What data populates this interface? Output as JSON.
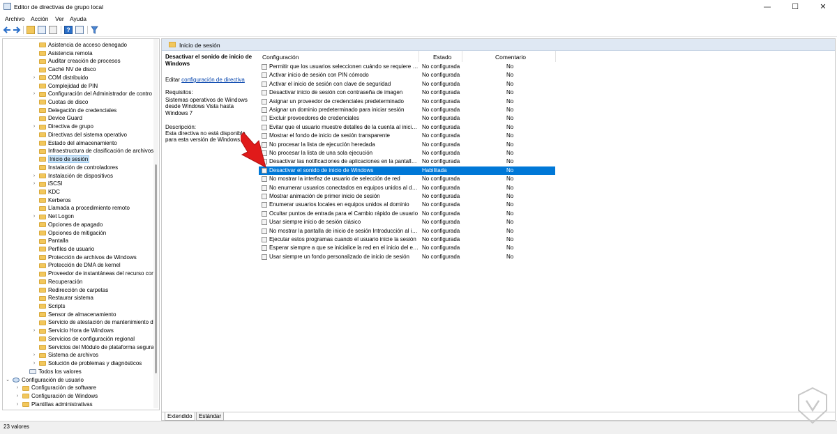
{
  "window": {
    "title": "Editor de directivas de grupo local",
    "controls": [
      "—",
      "☐",
      "✕"
    ]
  },
  "menu": [
    "Archivo",
    "Acción",
    "Ver",
    "Ayuda"
  ],
  "tree": [
    {
      "label": "Asistencia de acceso denegado",
      "level": 4,
      "expand": ""
    },
    {
      "label": "Asistencia remota",
      "level": 4,
      "expand": ""
    },
    {
      "label": "Auditar creación de procesos",
      "level": 4,
      "expand": ""
    },
    {
      "label": "Caché NV de disco",
      "level": 4,
      "expand": ""
    },
    {
      "label": "COM distribuido",
      "level": 4,
      "expand": ">"
    },
    {
      "label": "Complejidad de PIN",
      "level": 4,
      "expand": ""
    },
    {
      "label": "Configuración del Administrador de contro",
      "level": 4,
      "expand": ">"
    },
    {
      "label": "Cuotas de disco",
      "level": 4,
      "expand": ""
    },
    {
      "label": "Delegación de credenciales",
      "level": 4,
      "expand": ""
    },
    {
      "label": "Device Guard",
      "level": 4,
      "expand": ""
    },
    {
      "label": "Directiva de grupo",
      "level": 4,
      "expand": ">"
    },
    {
      "label": "Directivas del sistema operativo",
      "level": 4,
      "expand": ""
    },
    {
      "label": "Estado del almacenamiento",
      "level": 4,
      "expand": ""
    },
    {
      "label": "Infraestructura de clasificación de archivos",
      "level": 4,
      "expand": ""
    },
    {
      "label": "Inicio de sesión",
      "level": 4,
      "expand": "",
      "selected": true
    },
    {
      "label": "Instalación de controladores",
      "level": 4,
      "expand": ""
    },
    {
      "label": "Instalación de dispositivos",
      "level": 4,
      "expand": ">"
    },
    {
      "label": "iSCSI",
      "level": 4,
      "expand": ">"
    },
    {
      "label": "KDC",
      "level": 4,
      "expand": ""
    },
    {
      "label": "Kerberos",
      "level": 4,
      "expand": ""
    },
    {
      "label": "Llamada a procedimiento remoto",
      "level": 4,
      "expand": ""
    },
    {
      "label": "Net Logon",
      "level": 4,
      "expand": ">"
    },
    {
      "label": "Opciones de apagado",
      "level": 4,
      "expand": ""
    },
    {
      "label": "Opciones de mitigación",
      "level": 4,
      "expand": ""
    },
    {
      "label": "Pantalla",
      "level": 4,
      "expand": ""
    },
    {
      "label": "Perfiles de usuario",
      "level": 4,
      "expand": ""
    },
    {
      "label": "Protección de archivos de Windows",
      "level": 4,
      "expand": ""
    },
    {
      "label": "Protección de DMA de kernel",
      "level": 4,
      "expand": ""
    },
    {
      "label": "Proveedor de instantáneas del recurso com",
      "level": 4,
      "expand": ""
    },
    {
      "label": "Recuperación",
      "level": 4,
      "expand": ""
    },
    {
      "label": "Redirección de carpetas",
      "level": 4,
      "expand": ""
    },
    {
      "label": "Restaurar sistema",
      "level": 4,
      "expand": ""
    },
    {
      "label": "Scripts",
      "level": 4,
      "expand": ""
    },
    {
      "label": "Sensor de almacenamiento",
      "level": 4,
      "expand": ""
    },
    {
      "label": "Servicio de atestación de mantenimiento de",
      "level": 4,
      "expand": ""
    },
    {
      "label": "Servicio Hora de Windows",
      "level": 4,
      "expand": ">"
    },
    {
      "label": "Servicios de configuración regional",
      "level": 4,
      "expand": ""
    },
    {
      "label": "Servicios del Módulo de plataforma segura",
      "level": 4,
      "expand": ""
    },
    {
      "label": "Sistema de archivos",
      "level": 4,
      "expand": ">"
    },
    {
      "label": "Solución de problemas y diagnósticos",
      "level": 4,
      "expand": ">"
    },
    {
      "label": "Todos los valores",
      "level": 3,
      "expand": "",
      "icon": "settings"
    },
    {
      "label": "Configuración de usuario",
      "level": 0,
      "expand": "v",
      "icon": "user"
    },
    {
      "label": "Configuración de software",
      "level": 1,
      "expand": ">"
    },
    {
      "label": "Configuración de Windows",
      "level": 1,
      "expand": ">"
    },
    {
      "label": "Plantillas administrativas",
      "level": 1,
      "expand": ">"
    }
  ],
  "right_header": "Inicio de sesión",
  "description": {
    "title": "Desactivar el sonido de inicio de Windows",
    "edit_prefix": "Editar ",
    "edit_link": "configuración de directiva",
    "requirements_label": "Requisitos:",
    "requirements": "Sistemas operativos de Windows desde Windows Vista hasta Windows 7",
    "description_label": "Descripción:",
    "description": "Esta directiva no está disponible para esta versión de Windows."
  },
  "columns": {
    "name": "Configuración",
    "state": "Estado",
    "comment": "Comentario"
  },
  "rows": [
    {
      "name": "Permitir que los usuarios seleccionen cuándo se requiere un...",
      "state": "No configurada",
      "comment": "No"
    },
    {
      "name": "Activar inicio de sesión con PIN cómodo",
      "state": "No configurada",
      "comment": "No"
    },
    {
      "name": "Activar el inicio de sesión con clave de seguridad",
      "state": "No configurada",
      "comment": "No"
    },
    {
      "name": "Desactivar inicio de sesión con contraseña de imagen",
      "state": "No configurada",
      "comment": "No"
    },
    {
      "name": "Asignar un proveedor de credenciales predeterminado",
      "state": "No configurada",
      "comment": "No"
    },
    {
      "name": "Asignar un dominio predeterminado para iniciar sesión",
      "state": "No configurada",
      "comment": "No"
    },
    {
      "name": "Excluir proveedores de credenciales",
      "state": "No configurada",
      "comment": "No"
    },
    {
      "name": "Evitar que el usuario muestre detalles de la cuenta al iniciar s...",
      "state": "No configurada",
      "comment": "No"
    },
    {
      "name": "Mostrar el fondo de inicio de sesión transparente",
      "state": "No configurada",
      "comment": "No"
    },
    {
      "name": "No procesar la lista de ejecución heredada",
      "state": "No configurada",
      "comment": "No"
    },
    {
      "name": "No procesar la lista de una sola ejecución",
      "state": "No configurada",
      "comment": "No"
    },
    {
      "name": "Desactivar las notificaciones de aplicaciones en la pantalla d...",
      "state": "No configurada",
      "comment": "No"
    },
    {
      "name": "Desactivar el sonido de inicio de Windows",
      "state": "Habilitada",
      "comment": "No",
      "selected": true
    },
    {
      "name": "No mostrar la interfaz de usuario de selección de red",
      "state": "No configurada",
      "comment": "No"
    },
    {
      "name": "No enumerar usuarios conectados en equipos unidos al do...",
      "state": "No configurada",
      "comment": "No"
    },
    {
      "name": "Mostrar animación de primer inicio de sesión",
      "state": "No configurada",
      "comment": "No"
    },
    {
      "name": "Enumerar usuarios locales en equipos unidos al dominio",
      "state": "No configurada",
      "comment": "No"
    },
    {
      "name": "Ocultar puntos de entrada para el Cambio rápido de usuario",
      "state": "No configurada",
      "comment": "No"
    },
    {
      "name": "Usar siempre inicio de sesión clásico",
      "state": "No configurada",
      "comment": "No"
    },
    {
      "name": "No mostrar la pantalla de inicio de sesión Introducción al ini...",
      "state": "No configurada",
      "comment": "No"
    },
    {
      "name": "Ejecutar estos programas cuando el usuario inicie la sesión",
      "state": "No configurada",
      "comment": "No"
    },
    {
      "name": "Esperar siempre a que se inicialice la red en el inicio del equi...",
      "state": "No configurada",
      "comment": "No"
    },
    {
      "name": "Usar siempre un fondo personalizado de inicio de sesión",
      "state": "No configurada",
      "comment": "No"
    }
  ],
  "tabs": [
    "Extendido",
    "Estándar"
  ],
  "status": "23 valores",
  "colors": {
    "selection": "#0078d7",
    "header_bg": "#dfe8f3",
    "arrow": "#e01a1a"
  }
}
